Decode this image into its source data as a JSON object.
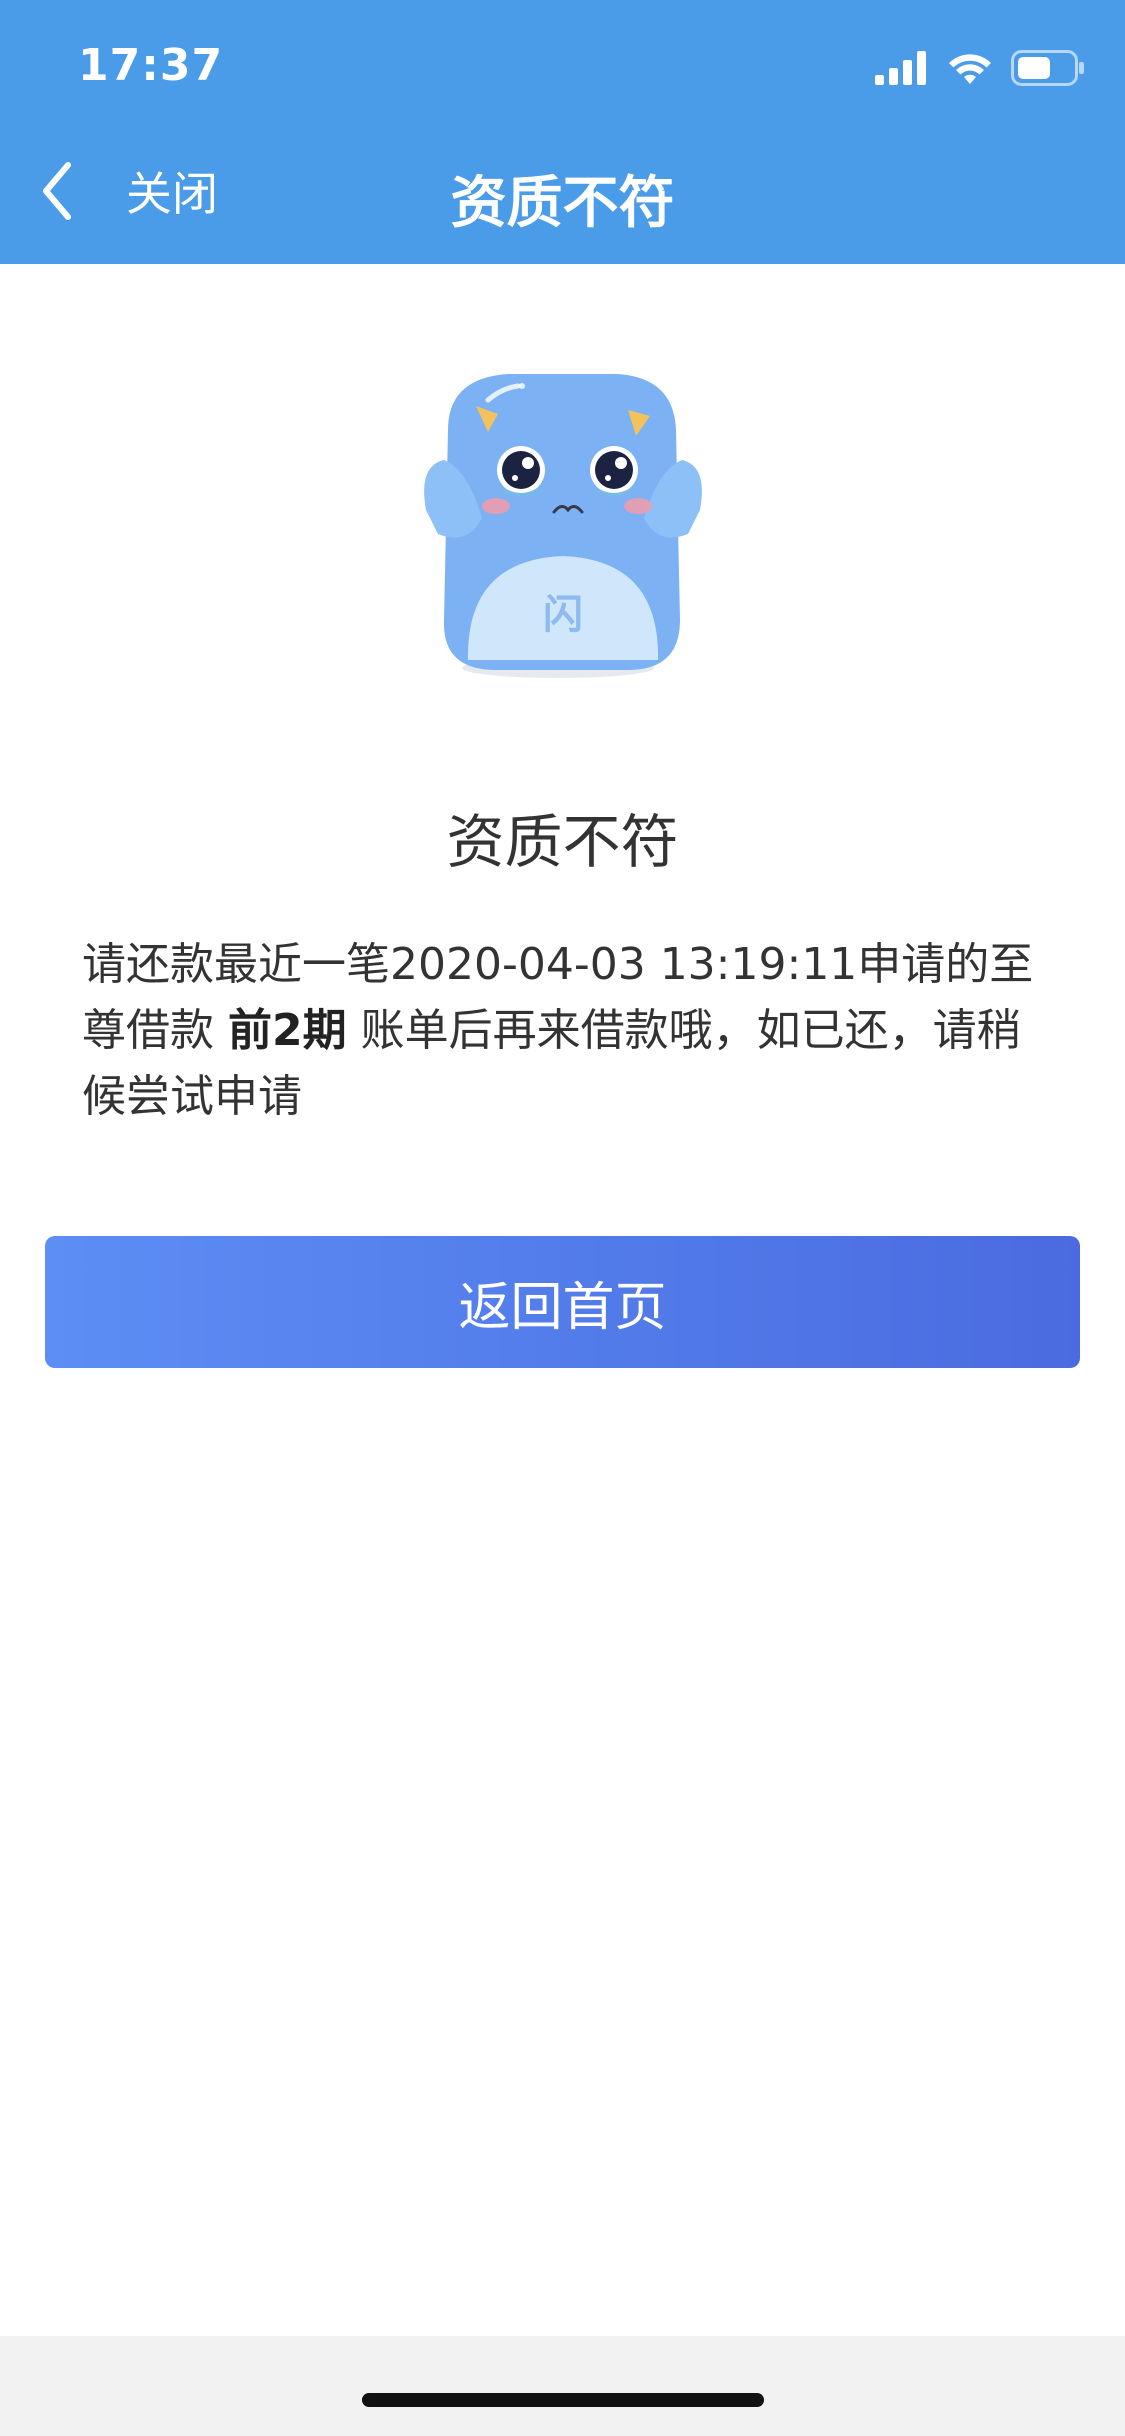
{
  "status_bar": {
    "time": "17:37"
  },
  "nav": {
    "back_label": "关闭",
    "title": "资质不符"
  },
  "mascot": {
    "badge_text": "闪"
  },
  "result": {
    "title": "资质不符",
    "message_part1": "请还款最近一笔2020-04-03 13:19:11申请的至尊借款 ",
    "message_emphasis": "前2期",
    "message_part2": " 账单后再来借款哦，如已还，请稍候尝试申请"
  },
  "actions": {
    "home_button_label": "返回首页"
  },
  "colors": {
    "header_bg": "#4a9be8",
    "button_gradient_start": "#5c8ef5",
    "button_gradient_end": "#4a6be0"
  }
}
